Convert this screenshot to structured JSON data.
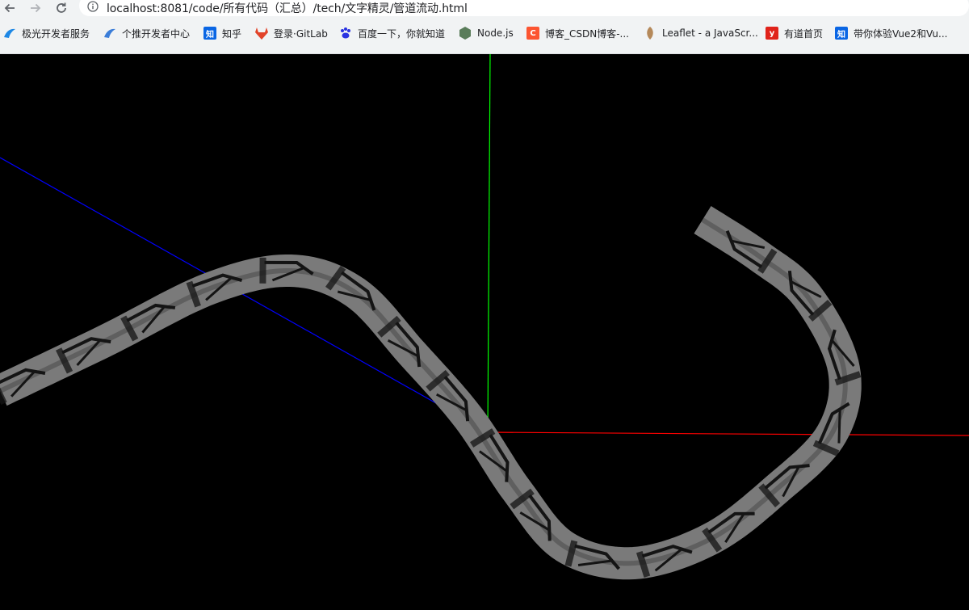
{
  "browser": {
    "url": "localhost:8081/code/所有代码（汇总）/tech/文字精灵/管道流动.html",
    "bookmarks": [
      {
        "label": "极光开发者服务",
        "icon": "jiguang-icon",
        "color": "#1e88e5"
      },
      {
        "label": "个推开发者中心",
        "icon": "getui-bird-icon",
        "color": "#3b7dd8"
      },
      {
        "label": "知乎",
        "icon": "zhihu-icon",
        "color": "#0a66e4",
        "glyph": "知"
      },
      {
        "label": "登录·GitLab",
        "icon": "gitlab-fox-icon",
        "color": "#e24329"
      },
      {
        "label": "百度一下，你就知道",
        "icon": "baidu-paw-icon",
        "color": "#2932e1"
      },
      {
        "label": "Node.js",
        "icon": "nodejs-hexagon-icon",
        "color": "#5a7d5a"
      },
      {
        "label": "博客_CSDN博客-...",
        "icon": "csdn-icon",
        "color": "#fc5531",
        "glyph": "C"
      },
      {
        "label": "Leaflet - a JavaScr...",
        "icon": "leaflet-leaf-icon",
        "color": "#b5895a"
      },
      {
        "label": "有道首页",
        "icon": "youdao-icon",
        "color": "#e0231a",
        "glyph": "y"
      },
      {
        "label": "带你体验Vue2和Vu...",
        "icon": "zhihu-icon",
        "color": "#0a66e4",
        "glyph": "知"
      }
    ]
  },
  "scene": {
    "background": "#000000",
    "axes": {
      "x_color": "#ff0000",
      "y_color": "#00ff00",
      "z_color": "#0000ff"
    },
    "tube_color": "#7a7a7a",
    "stripe_color": "#141414"
  }
}
